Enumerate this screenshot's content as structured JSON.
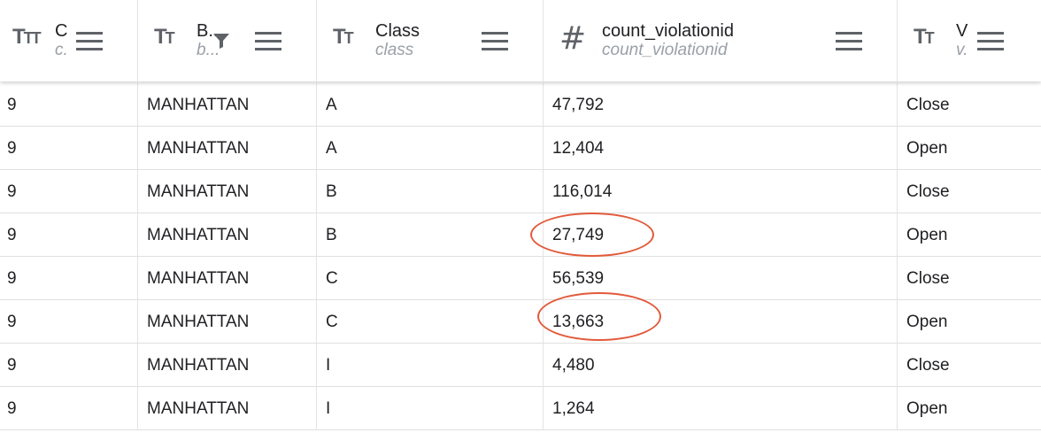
{
  "colors": {
    "annotation": "#e25a3b",
    "icon": "#5f6368",
    "subtitle": "#9aa0a6"
  },
  "columns": [
    {
      "title": "C",
      "subtitle": "c.",
      "type_icon": "text-type-icon",
      "filtered": false
    },
    {
      "title": "B..",
      "subtitle": "b...",
      "type_icon": "text-type-icon",
      "filtered": true
    },
    {
      "title": "Class",
      "subtitle": "class",
      "type_icon": "text-type-icon",
      "filtered": false
    },
    {
      "title": "count_violationid",
      "subtitle": "count_violationid",
      "type_icon": "hash-icon",
      "filtered": false
    },
    {
      "title": "V",
      "subtitle": "v.",
      "type_icon": "text-type-icon",
      "filtered": false
    }
  ],
  "rows": [
    {
      "c": "9",
      "b": "MANHATTAN",
      "class": "A",
      "count": "47,792",
      "v": "Close",
      "circled": false
    },
    {
      "c": "9",
      "b": "MANHATTAN",
      "class": "A",
      "count": "12,404",
      "v": "Open",
      "circled": false
    },
    {
      "c": "9",
      "b": "MANHATTAN",
      "class": "B",
      "count": "116,014",
      "v": "Close",
      "circled": false
    },
    {
      "c": "9",
      "b": "MANHATTAN",
      "class": "B",
      "count": "27,749",
      "v": "Open",
      "circled": true
    },
    {
      "c": "9",
      "b": "MANHATTAN",
      "class": "C",
      "count": "56,539",
      "v": "Close",
      "circled": false
    },
    {
      "c": "9",
      "b": "MANHATTAN",
      "class": "C",
      "count": "13,663",
      "v": "Open",
      "circled": true
    },
    {
      "c": "9",
      "b": "MANHATTAN",
      "class": "I",
      "count": "4,480",
      "v": "Close",
      "circled": false
    },
    {
      "c": "9",
      "b": "MANHATTAN",
      "class": "I",
      "count": "1,264",
      "v": "Open",
      "circled": false
    }
  ]
}
